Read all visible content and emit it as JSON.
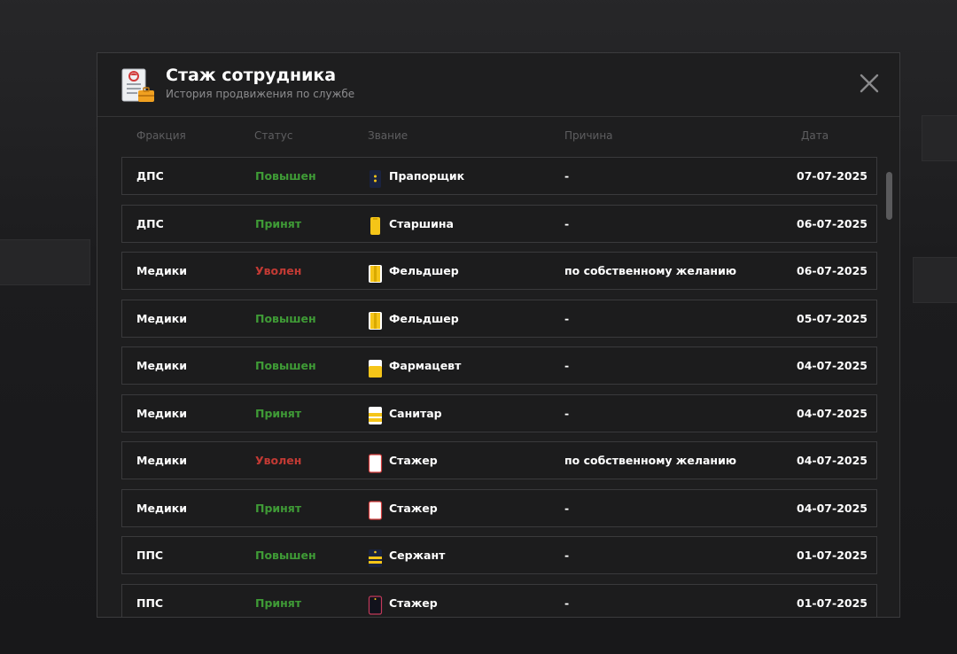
{
  "modal": {
    "title": "Стаж сотрудника",
    "subtitle": "История продвижения по службе"
  },
  "icons": {
    "header": "employment-record-icon",
    "close": "close-icon"
  },
  "columns": {
    "faction": "Фракция",
    "status": "Статус",
    "rank": "Звание",
    "reason": "Причина",
    "date": "Дата"
  },
  "colors": {
    "status_positive": "#3f9b36",
    "status_negative": "#c23a34",
    "rank_yellow": "#f5c518",
    "rank_navy": "#1a2340"
  },
  "rows": [
    {
      "faction": "ДПС",
      "status": "Повышен",
      "status_type": "up",
      "rank": "Прапорщик",
      "rank_icon": "navy-epaulet-icon",
      "reason": "-",
      "date": "07-07-2025"
    },
    {
      "faction": "ДПС",
      "status": "Принят",
      "status_type": "up",
      "rank": "Старшина",
      "rank_icon": "yellow-epaulet-icon",
      "reason": "-",
      "date": "06-07-2025"
    },
    {
      "faction": "Медики",
      "status": "Уволен",
      "status_type": "fired",
      "rank": "Фельдшер",
      "rank_icon": "yellow-striped-epaulet-icon",
      "reason": "по собственному желанию",
      "date": "06-07-2025"
    },
    {
      "faction": "Медики",
      "status": "Повышен",
      "status_type": "up",
      "rank": "Фельдшер",
      "rank_icon": "yellow-striped-epaulet-icon",
      "reason": "-",
      "date": "05-07-2025"
    },
    {
      "faction": "Медики",
      "status": "Повышен",
      "status_type": "up",
      "rank": "Фармацевт",
      "rank_icon": "white-yellow-epaulet-icon",
      "reason": "-",
      "date": "04-07-2025"
    },
    {
      "faction": "Медики",
      "status": "Принят",
      "status_type": "up",
      "rank": "Санитар",
      "rank_icon": "white-yellow-stripes-epaulet-icon",
      "reason": "-",
      "date": "04-07-2025"
    },
    {
      "faction": "Медики",
      "status": "Уволен",
      "status_type": "fired",
      "rank": "Стажер",
      "rank_icon": "white-epaulet-icon",
      "reason": "по собственному желанию",
      "date": "04-07-2025"
    },
    {
      "faction": "Медики",
      "status": "Принят",
      "status_type": "up",
      "rank": "Стажер",
      "rank_icon": "white-epaulet-icon",
      "reason": "-",
      "date": "04-07-2025"
    },
    {
      "faction": "ППС",
      "status": "Повышен",
      "status_type": "up",
      "rank": "Сержант",
      "rank_icon": "navy-yellow-stripes-epaulet-icon",
      "reason": "-",
      "date": "01-07-2025"
    },
    {
      "faction": "ППС",
      "status": "Принят",
      "status_type": "up",
      "rank": "Стажер",
      "rank_icon": "dark-epaulet-icon",
      "reason": "-",
      "date": "01-07-2025"
    }
  ]
}
